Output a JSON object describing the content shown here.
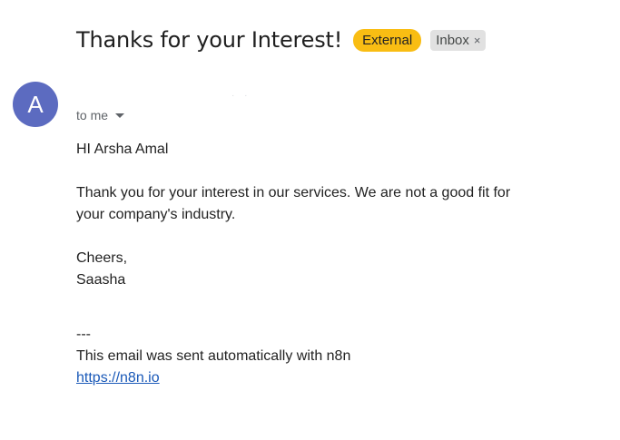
{
  "email": {
    "subject": "Thanks for your Interest!",
    "labels": {
      "external": "External",
      "inbox": "Inbox",
      "inbox_remove": "×"
    },
    "sender": {
      "avatar_letter": "A",
      "name_placeholder": "· ·"
    },
    "recipient": "to me",
    "body": {
      "greeting": "HI Arsha Amal",
      "paragraph": "Thank you for your interest in our services. We are not a good fit for your company's industry.",
      "signoff": "Cheers,",
      "signature": "Saasha",
      "separator": "---",
      "footer": "This email was sent automatically with n8n",
      "link": "https://n8n.io"
    }
  },
  "colors": {
    "external_badge": "#f9bd13",
    "inbox_badge": "#e1e1e1",
    "avatar": "#5c6bc0",
    "link": "#1a59b8"
  },
  "icons": {
    "recipient_dropdown": "chevron-down-icon",
    "label_remove": "close-icon"
  }
}
